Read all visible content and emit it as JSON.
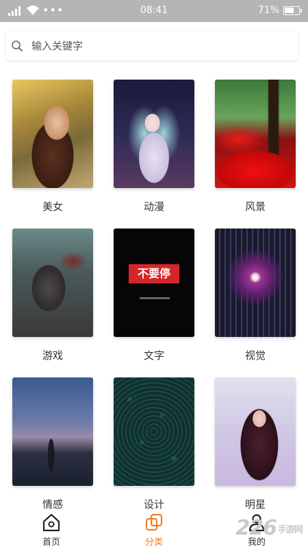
{
  "status_bar": {
    "time": "08:41",
    "battery": "71%",
    "battery_level": 0.71,
    "dots": "•••"
  },
  "search": {
    "placeholder": "输入关键字",
    "value": ""
  },
  "categories": [
    {
      "label": "美女"
    },
    {
      "label": "动漫"
    },
    {
      "label": "风景"
    },
    {
      "label": "游戏"
    },
    {
      "label": "文字",
      "thumb_text": "不要停"
    },
    {
      "label": "视觉"
    },
    {
      "label": "情感"
    },
    {
      "label": "设计"
    },
    {
      "label": "明星"
    }
  ],
  "nav": {
    "items": [
      {
        "label": "首页",
        "icon": "home-icon"
      },
      {
        "label": "分类",
        "icon": "category-icon",
        "active": true
      },
      {
        "label": "我的",
        "icon": "user-icon"
      }
    ],
    "active_color": "#f47b2a"
  },
  "watermark": {
    "text": "226",
    "suffix": "手游网"
  }
}
